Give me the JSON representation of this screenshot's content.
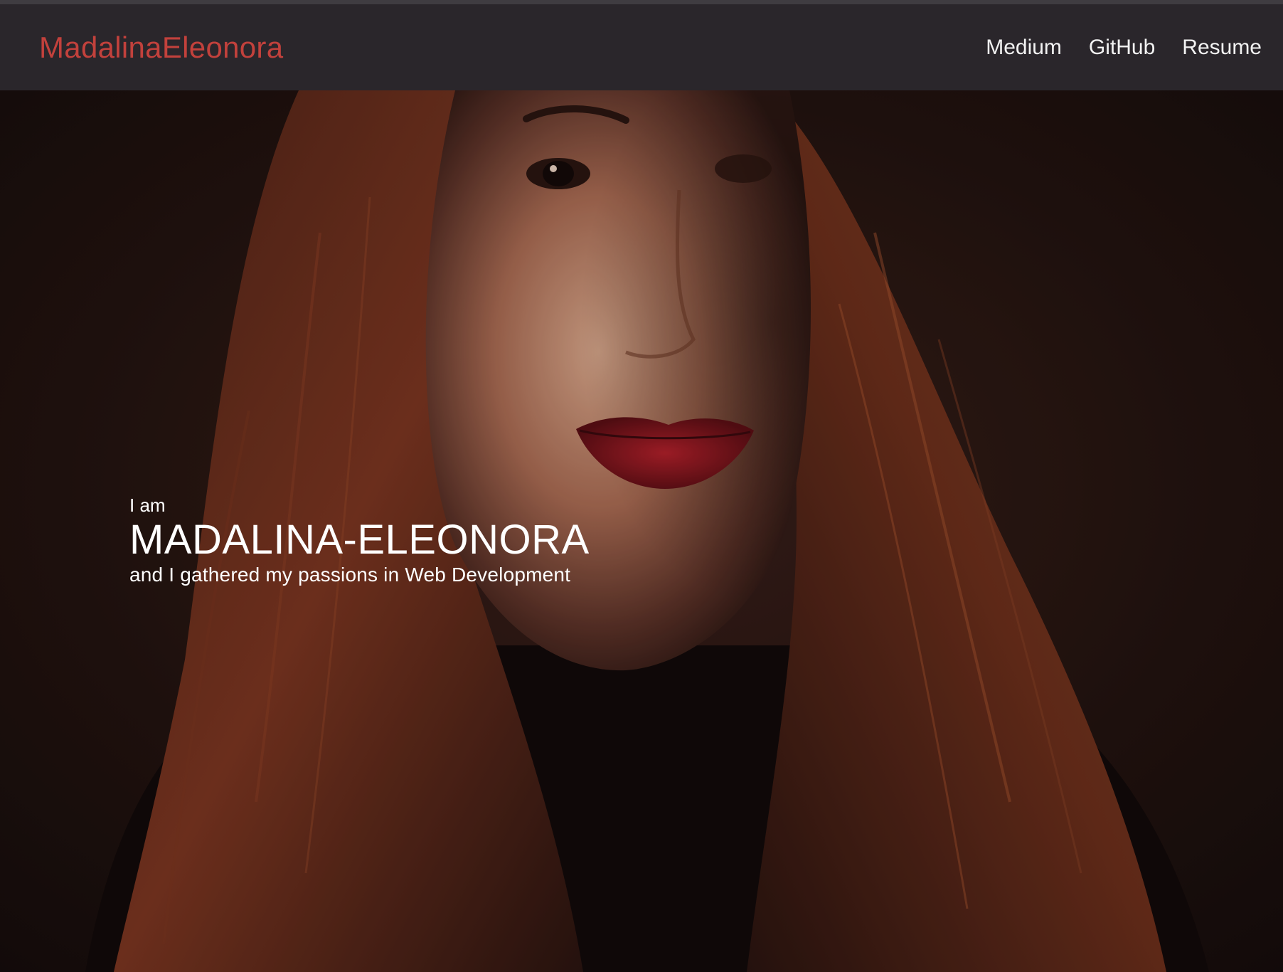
{
  "navbar": {
    "brand": "MadalinaEleonora",
    "links": [
      {
        "label": "Medium"
      },
      {
        "label": "GitHub"
      },
      {
        "label": "Resume"
      }
    ]
  },
  "hero": {
    "intro": "I am",
    "name": "MADALINA-ELEONORA",
    "tagline": "and I gathered my passions in Web Development"
  },
  "colors": {
    "navbar_bg": "#2a262b",
    "brand": "#c2413c",
    "nav_text": "#f2f2f2",
    "hero_text": "#ffffff"
  }
}
